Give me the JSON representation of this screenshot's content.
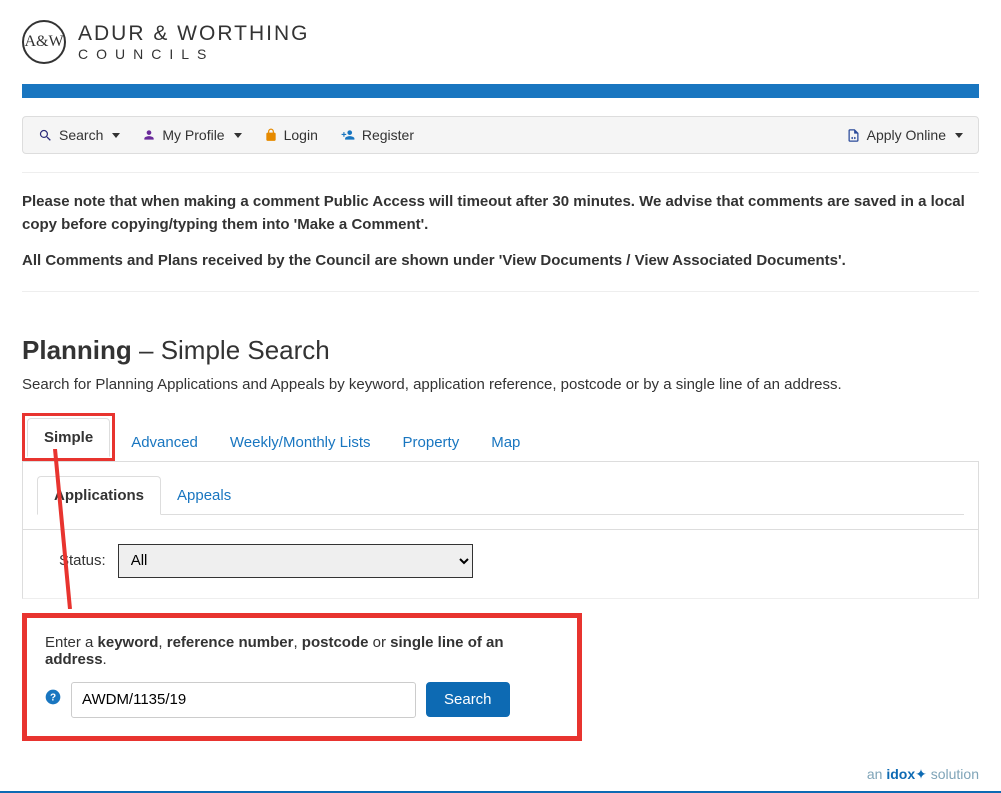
{
  "header": {
    "logo_circle": "A&W",
    "logo_title": "ADUR & WORTHING",
    "logo_sub": "COUNCILS"
  },
  "nav": {
    "search": "Search",
    "profile": "My Profile",
    "login": "Login",
    "register": "Register",
    "apply": "Apply Online"
  },
  "notice": {
    "p1_a": "Please note that when making a comment Public Access will timeout after 30 minutes. We advise that comments are saved in a local copy before copying/typing them into 'Make a Comment'.",
    "p2_a": "All Comments and Plans received by the Council are shown under 'View Documents / View Associated Documents'."
  },
  "page": {
    "title_strong": "Planning",
    "title_rest": " – Simple Search",
    "subtitle": "Search for Planning Applications and Appeals by keyword, application reference, postcode or by a single line of an address."
  },
  "tabs": {
    "simple": "Simple",
    "advanced": "Advanced",
    "weekly": "Weekly/Monthly Lists",
    "property": "Property",
    "map": "Map"
  },
  "subtabs": {
    "applications": "Applications",
    "appeals": "Appeals"
  },
  "status": {
    "label": "Status:",
    "value": "All"
  },
  "searchbox": {
    "instruction_pre": "Enter a ",
    "kw": "keyword",
    "sep1": ", ",
    "ref": "reference number",
    "sep2": ", ",
    "pc": "postcode",
    "sep3": " or ",
    "addr": "single line of an address",
    "end": ".",
    "input_value": "AWDM/1135/19",
    "button": "Search",
    "help": "?"
  },
  "footer": {
    "an": "an ",
    "idox": "idox",
    "solution": " solution"
  }
}
